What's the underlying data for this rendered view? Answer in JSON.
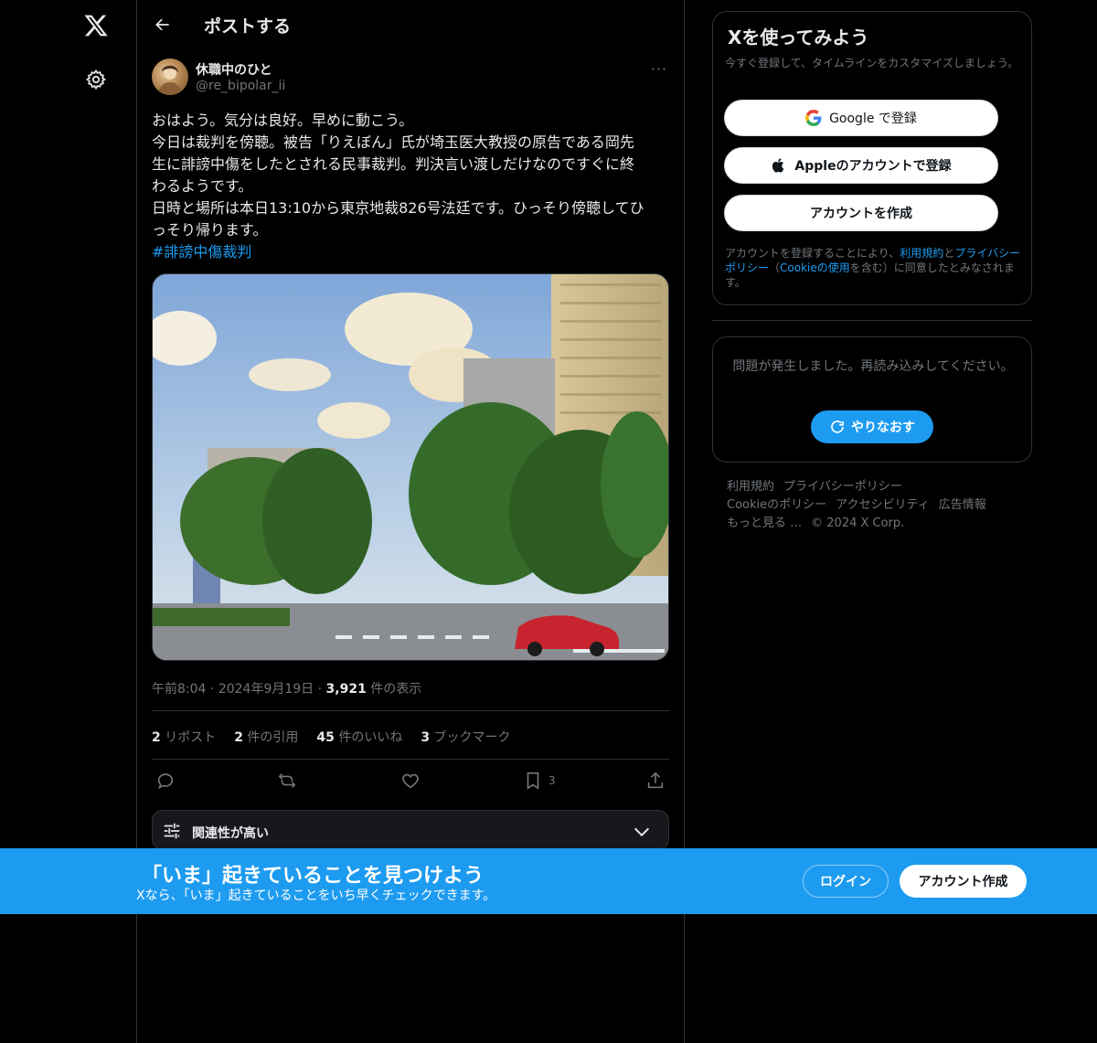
{
  "app": {
    "logo_icon": "x-logo-icon",
    "settings_icon": "gear-icon"
  },
  "header": {
    "title": "ポストする",
    "back_icon": "arrow-left-icon"
  },
  "post": {
    "display_name": "休職中のひと",
    "handle": "@re_bipolar_ii",
    "more_label": "···",
    "lines": [
      "おはよう。気分は良好。早めに動こう。",
      "今日は裁判を傍聴。被告「りえぼん」氏が埼玉医大教授の原告である岡先",
      "生に誹謗中傷をしたとされる民事裁判。判決言い渡しだけなのですぐに終",
      "わるようです。",
      "日時と場所は本日13:10から東京地裁826号法廷です。ひっそり傍聴してひ",
      "っそり帰ります。"
    ],
    "hashtag": "#誹謗中傷裁判",
    "time": "午前8:04",
    "date": "2024年9月19日",
    "views_count": "3,921",
    "views_label": "件の表示",
    "stats": [
      {
        "count": "2",
        "label": "リポスト"
      },
      {
        "count": "2",
        "label": "件の引用"
      },
      {
        "count": "45",
        "label": "件のいいね"
      },
      {
        "count": "3",
        "label": "ブックマーク"
      }
    ],
    "bookmark_count": "3",
    "relevance_label": "関連性が高い"
  },
  "signup": {
    "title": "Xを使ってみよう",
    "subtitle": "今すぐ登録して、タイムラインをカスタマイズしましょう。",
    "google_label": "Google で登録",
    "apple_label": "Appleのアカウントで登録",
    "create_label": "アカウントを作成",
    "legal_prefix": "アカウントを登録することにより、",
    "legal_terms": "利用規約",
    "legal_and": "と",
    "legal_privacy": "プライバシーポリシー",
    "legal_open": "（",
    "legal_cookie": "Cookieの使用",
    "legal_suffix": "を含む）に同意したとみなされます。"
  },
  "error": {
    "message": "問題が発生しました。再読み込みしてください。",
    "retry_label": "やりなおす"
  },
  "footer": {
    "links": [
      "利用規約",
      "プライバシーポリシー",
      "Cookieのポリシー",
      "アクセシビリティ",
      "広告情報",
      "もっと見る …"
    ],
    "copyright": "© 2024 X Corp."
  },
  "banner": {
    "title": "「いま」起きていることを見つけよう",
    "subtitle": "Xなら、「いま」起きていることをいち早くチェックできます。",
    "login_label": "ログイン",
    "create_label": "アカウント作成"
  },
  "colors": {
    "accent": "#1d9bf0",
    "background": "#000000",
    "text": "#e7e9ea",
    "muted": "#71767b",
    "border": "#2f3336"
  }
}
